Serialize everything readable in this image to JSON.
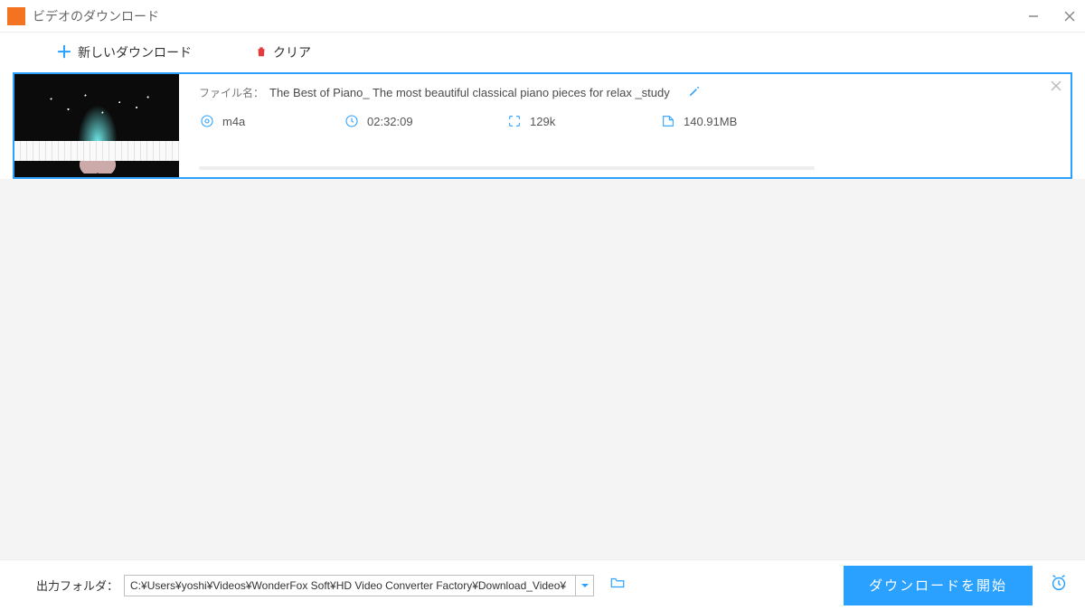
{
  "titlebar": {
    "title": "ビデオのダウンロード"
  },
  "toolbar": {
    "new_download": "新しいダウンロード",
    "clear": "クリア"
  },
  "item": {
    "filename_label": "ファイル名：",
    "filename": "The Best of Piano_ The most beautiful classical piano pieces for relax _study",
    "format": "m4a",
    "duration": "02:32:09",
    "resolution": "129k",
    "filesize": "140.91MB"
  },
  "footer": {
    "output_label": "出力フォルダ：",
    "output_path": "C:¥Users¥yoshi¥Videos¥WonderFox Soft¥HD Video Converter Factory¥Download_Video¥",
    "start_button": "ダウンロードを開始"
  }
}
